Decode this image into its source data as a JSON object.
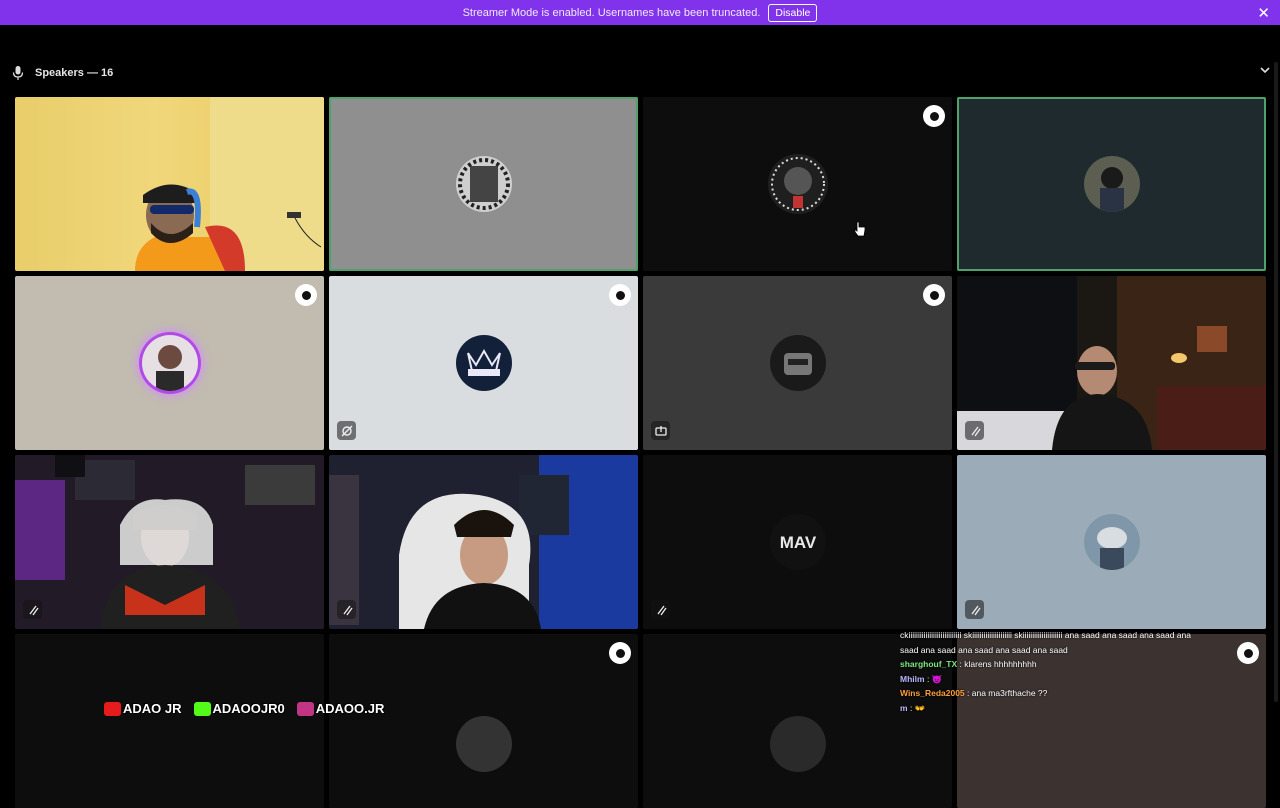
{
  "banner": {
    "message": "Streamer Mode is enabled. Usernames have been truncated.",
    "disable_label": "Disable",
    "close_glyph": "✕"
  },
  "section": {
    "title": "Speakers — 16",
    "chevron": "⌄"
  },
  "overlay_tags": [
    {
      "platform": "youtube",
      "text": "ADAO JR",
      "color": "#e61b1b"
    },
    {
      "platform": "kick",
      "text": "ADAOOJR0",
      "color": "#53fc18"
    },
    {
      "platform": "instagram",
      "text": "ADAOO.JR",
      "color": "#c13584"
    }
  ],
  "chat": [
    {
      "user": "",
      "message": "ckiiiiiiiiiiiiiiiiiiiiiiiiiiii skiiiiiiiiiiiiiiiiiiiii skiiiiiiiiiiiiiiiiiiiii ana saad ana saad ana saad ana"
    },
    {
      "user": "",
      "message": "saad ana saad ana saad ana saad ana saad"
    },
    {
      "user": "sharghouf_TX",
      "message": ": klarens hhhhhhhhh",
      "cls": "u1"
    },
    {
      "user": "Mhilm",
      "message": ": 👿",
      "cls": "u2"
    },
    {
      "user": "Wins_Reda2005",
      "message": ": ana ma3rfthache ??",
      "cls": "u3"
    },
    {
      "user": "m",
      "message": ": 👐",
      "cls": "u2"
    }
  ],
  "colors": {
    "banner": "#8033ea",
    "speaking_outline": "#4fa36a",
    "background": "#000000"
  }
}
